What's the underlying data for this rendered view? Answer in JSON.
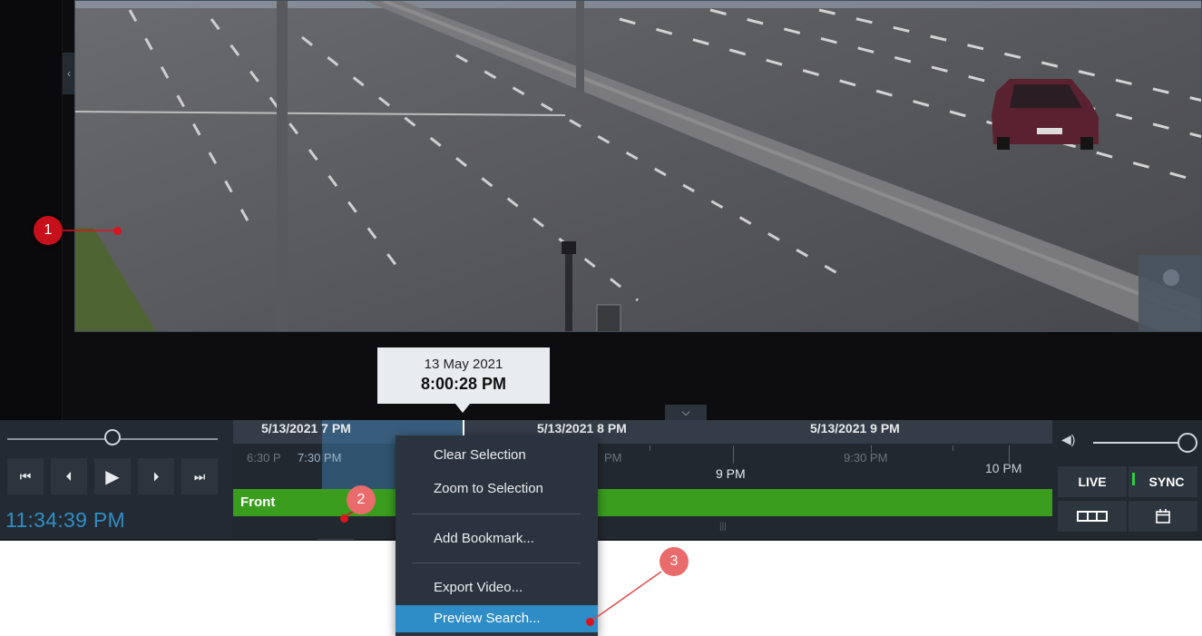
{
  "tooltip": {
    "date": "13 May 2021",
    "time": "8:00:28 PM"
  },
  "timeline": {
    "hour_labels": [
      "5/13/2021 7 PM",
      "5/13/2021 8 PM",
      "5/13/2021 9 PM"
    ],
    "ruler_labels": [
      "6:30 P",
      "7:30 PM",
      "PM",
      "9 PM",
      "9:30 PM",
      "10 PM"
    ],
    "track_name": "Front",
    "clock": "11:34:39 PM"
  },
  "transport": {
    "skip_back": "⏮",
    "step_back": "⏴",
    "play": "▶",
    "step_forward": "⏵",
    "skip_forward": "⏭"
  },
  "right_panel": {
    "live_label": "LIVE",
    "sync_label": "SYNC",
    "volume_icon": "speaker-icon"
  },
  "context_menu": {
    "items": [
      "Clear Selection",
      "Zoom to Selection",
      "Add Bookmark...",
      "Export Video...",
      "Preview Search..."
    ],
    "highlighted": "Preview Search..."
  },
  "callouts": [
    "1",
    "2",
    "3"
  ],
  "colors": {
    "accent": "#2e8cc6",
    "track": "#3a9d1e",
    "callout": "#c8101c",
    "sync": "#2ed043"
  }
}
